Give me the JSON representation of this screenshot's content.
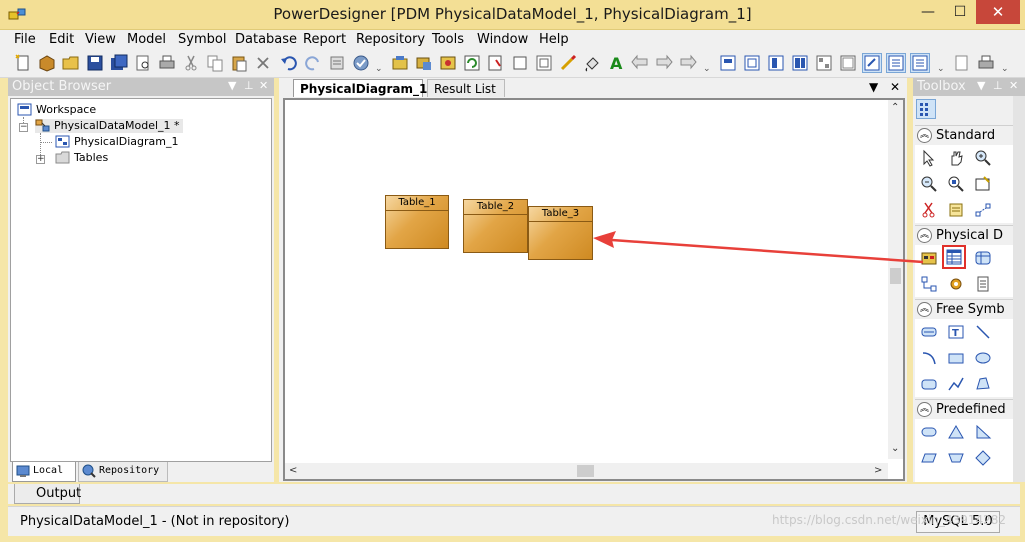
{
  "window": {
    "title": "PowerDesigner [PDM PhysicalDataModel_1, PhysicalDiagram_1]",
    "controls": {
      "minimize": "—",
      "maximize": "☐",
      "close": "✕"
    }
  },
  "menu": [
    "File",
    "Edit",
    "View",
    "Model",
    "Symbol",
    "Database",
    "Report",
    "Repository",
    "Tools",
    "Window",
    "Help"
  ],
  "object_browser": {
    "title": "Object Browser",
    "controls": {
      "dropdown": "▼",
      "pin": "⊥",
      "close": "✕"
    },
    "tree": {
      "workspace": "Workspace",
      "model": "PhysicalDataModel_1 *",
      "diagram": "PhysicalDiagram_1",
      "tables_folder": "Tables",
      "expander_collapse": "−",
      "expander_expand": "+"
    },
    "tabs": {
      "local": "Local",
      "repository": "Repository"
    }
  },
  "diagram": {
    "tabs": {
      "diagram": "PhysicalDiagram_1",
      "result": "Result List"
    },
    "controls": {
      "dropdown": "▼",
      "close": "✕"
    },
    "tables": [
      "Table_1",
      "Table_2",
      "Table_3"
    ],
    "scroll": {
      "up": "⌃",
      "down": "⌄",
      "left": "<",
      "right": ">"
    }
  },
  "toolbox": {
    "title": "Toolbox",
    "controls": {
      "dropdown": "▼",
      "pin": "⊥",
      "close": "✕"
    },
    "sections": {
      "standard": "Standard",
      "physical": "Physical D",
      "free": "Free Symb",
      "predefined": "Predefined"
    },
    "chevron": "︽",
    "highlighted_tool": "table-tool-icon"
  },
  "output": {
    "label": "Output"
  },
  "status": {
    "text": "PhysicalDataModel_1 - (Not in repository)",
    "dbms": "MySQL 5.0"
  },
  "watermark": "https://blog.csdn.net/weixin_43914282",
  "colors": {
    "title_bar": "#f3df95",
    "table_fill": "#e2a546",
    "highlight_box": "#e0302a",
    "arrow": "#e8403a"
  }
}
